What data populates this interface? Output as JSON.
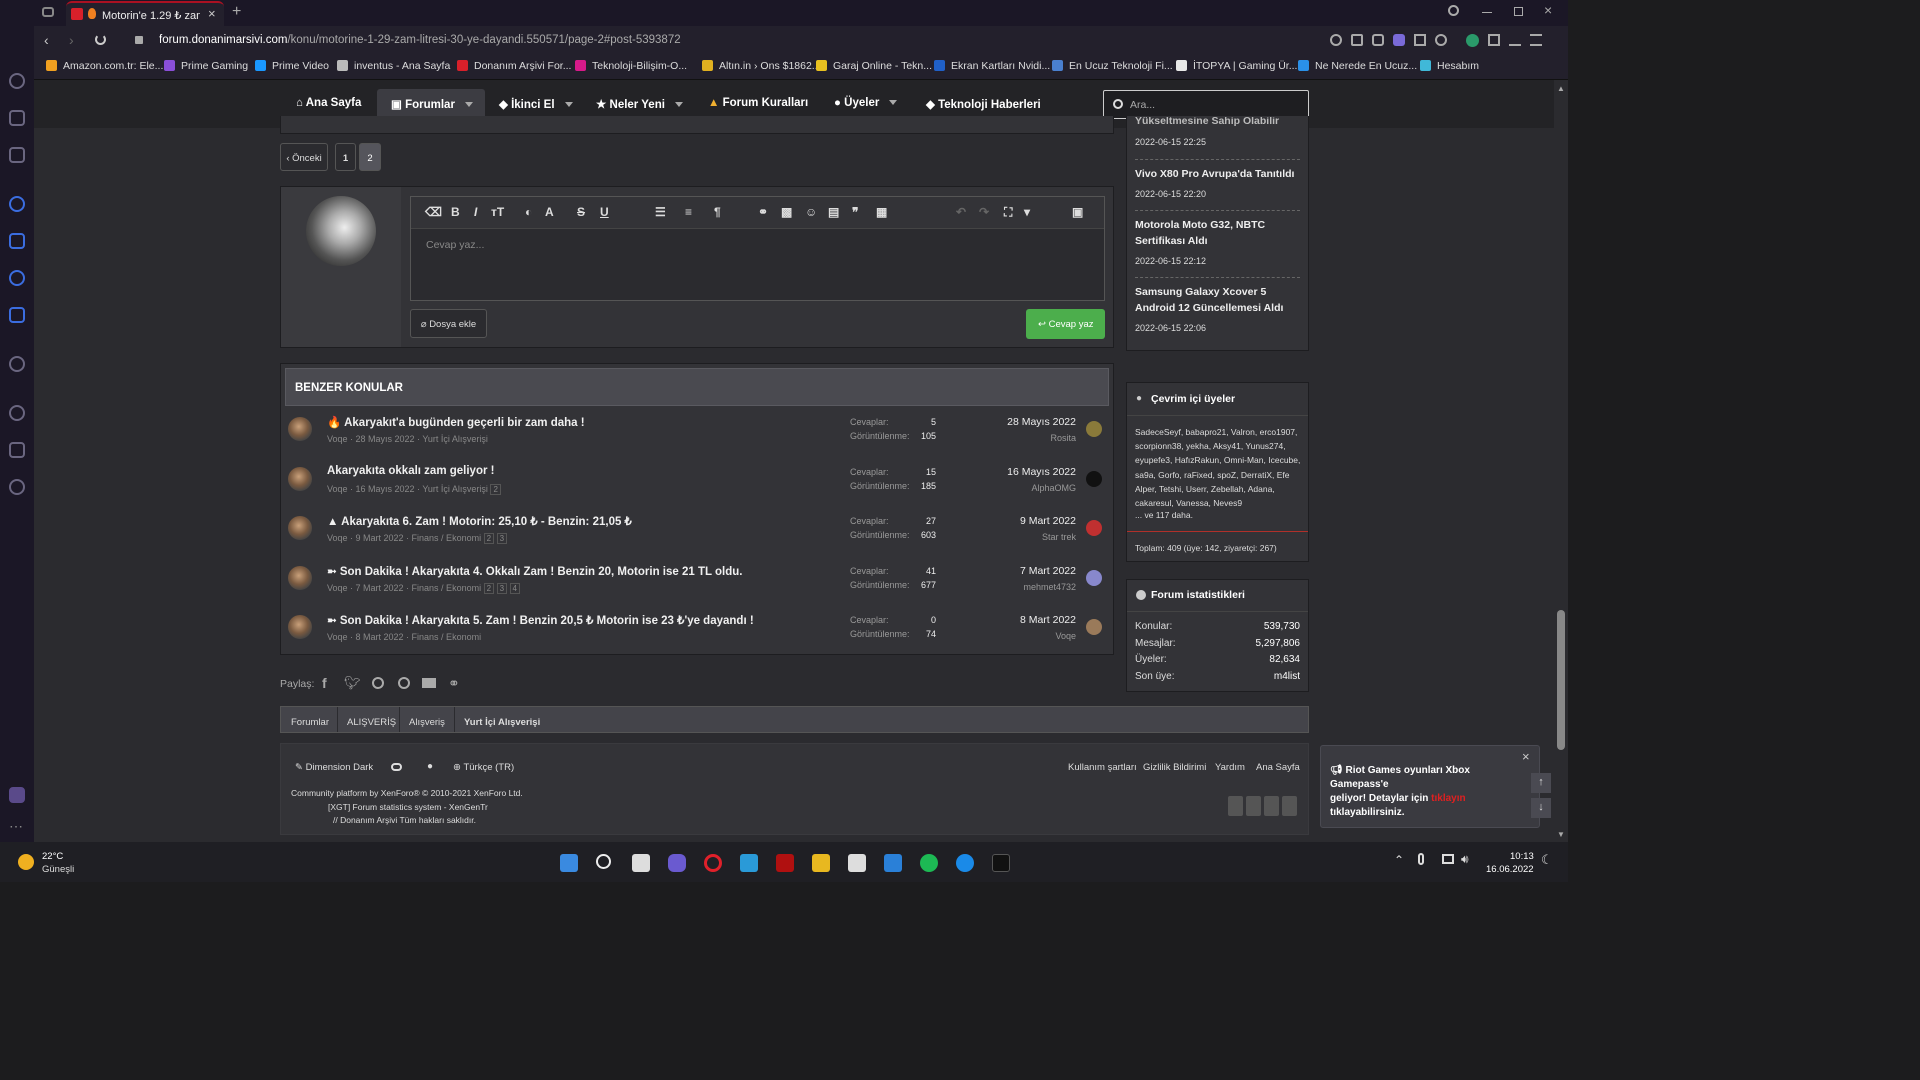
{
  "browser": {
    "tab_title": "Motorin'e 1.29 ₺ zam ! ",
    "url_domain": "forum.donanimarsivi.com",
    "url_path": "/konu/motorine-1-29-zam-litresi-30-ye-dayandi.550571/page-2#post-5393872",
    "bookmarks": [
      {
        "label": "Amazon.com.tr: Ele...",
        "color": "#f0a020"
      },
      {
        "label": "Prime Gaming",
        "color": "#8a4fd8"
      },
      {
        "label": "Prime Video",
        "color": "#1a98ff"
      },
      {
        "label": "inventus - Ana Sayfa",
        "color": "#bbbbbb"
      },
      {
        "label": "Donanım Arşivi For...",
        "color": "#d8202a"
      },
      {
        "label": "Teknoloji-Bilişim-O...",
        "color": "#d81a8a"
      },
      {
        "label": "Altın.in › Ons $1862...",
        "color": "#e0b020"
      },
      {
        "label": "Garaj Online - Tekn...",
        "color": "#e8c020"
      },
      {
        "label": "Ekran Kartları Nvidi...",
        "color": "#2060c8"
      },
      {
        "label": "En Ucuz Teknoloji Fi...",
        "color": "#4a80d0"
      },
      {
        "label": "İTOPYA | Gaming Ür...",
        "color": "#e8e8e8"
      },
      {
        "label": "Ne Nerede En Ucuz...",
        "color": "#2a90e8"
      },
      {
        "label": "Hesabım",
        "color": "#40b8d8"
      }
    ]
  },
  "nav": {
    "items": [
      {
        "label": "Ana Sayfa",
        "icon": "home-icon"
      },
      {
        "label": "Forumlar",
        "icon": "comments-icon"
      },
      {
        "label": "İkinci El",
        "icon": "tag-icon"
      },
      {
        "label": "Neler Yeni",
        "icon": "star-icon"
      },
      {
        "label": "Forum Kuralları",
        "icon": "warning-icon"
      },
      {
        "label": "Üyeler",
        "icon": "user-icon"
      },
      {
        "label": "Teknoloji Haberleri",
        "icon": "tag-icon"
      }
    ],
    "search_placeholder": "Ara..."
  },
  "pagination": {
    "prev": "‹ Önceki",
    "pages": [
      "1",
      "2"
    ]
  },
  "editor": {
    "placeholder": "Cevap yaz...",
    "attach": "Dosya ekle",
    "submit": "Cevap yaz"
  },
  "similar": {
    "title": "BENZER KONULAR",
    "replies_label": "Cevaplar:",
    "views_label": "Görüntülenme:",
    "threads": [
      {
        "prefix": "🔥",
        "title": "Akaryakıt'a bugünden geçerli bir zam daha !",
        "meta": "Voqe · 28 Mayıs 2022 · Yurt İçi Alışverişi",
        "pages": [],
        "replies": "5",
        "views": "105",
        "date": "28 Mayıs 2022",
        "last": "Rosita",
        "lastColor": "#8a7a3a"
      },
      {
        "prefix": "",
        "title": "Akaryakıta okkalı zam geliyor !",
        "meta": "Voqe · 16 Mayıs 2022 · Yurt İçi Alışverişi",
        "pages": [
          "2"
        ],
        "replies": "15",
        "views": "185",
        "date": "16 Mayıs 2022",
        "last": "AlphaOMG",
        "lastColor": "#111111"
      },
      {
        "prefix": "",
        "title": "▲ Akaryakıta 6. Zam ! Motorin: 25,10 ₺ - Benzin: 21,05 ₺",
        "meta": "Voqe · 9 Mart 2022 · Finans / Ekonomi",
        "pages": [
          "2",
          "3"
        ],
        "replies": "27",
        "views": "603",
        "date": "9 Mart 2022",
        "last": "Star trek",
        "lastColor": "#c03030"
      },
      {
        "prefix": "",
        "title": "➼ Son Dakika ! Akaryakıta 4. Okkalı Zam ! Benzin 20, Motorin ise 21 TL oldu.",
        "meta": "Voqe · 7 Mart 2022 · Finans / Ekonomi",
        "pages": [
          "2",
          "3",
          "4"
        ],
        "replies": "41",
        "views": "677",
        "date": "7 Mart 2022",
        "last": "mehmet4732",
        "lastColor": "#8888cc"
      },
      {
        "prefix": "",
        "title": "➼ Son Dakika ! Akaryakıta 5. Zam ! Benzin 20,5 ₺ Motorin ise 23 ₺'ye dayandı !",
        "meta": "Voqe · 8 Mart 2022 · Finans / Ekonomi",
        "pages": [],
        "replies": "0",
        "views": "74",
        "date": "8 Mart 2022",
        "last": "Voqe",
        "lastColor": "#9a7a5a"
      }
    ]
  },
  "share": {
    "label": "Paylaş:"
  },
  "breadcrumb": [
    "Forumlar",
    "ALIŞVERİŞ",
    "Alışveriş",
    "Yurt İçi Alışverişi"
  ],
  "footer": {
    "style": "Dimension Dark",
    "lang": "Türkçe (TR)",
    "links": [
      "Kullanım şartları",
      "Gizlilik Bildirimi",
      "Yardım",
      "Ana Sayfa"
    ],
    "copy1": "Community platform by XenForo® © 2010-2021 XenForo Ltd.",
    "copy2": "[XGT] Forum statistics system - XenGenTr",
    "copy3": "// Donanım Arşivi Tüm hakları saklıdır."
  },
  "news": [
    {
      "title": "Yükseltmesine Sahip Olabilir",
      "date": "2022-06-15 22:25"
    },
    {
      "title": "Vivo X80 Pro Avrupa'da Tanıtıldı",
      "date": "2022-06-15 22:20"
    },
    {
      "title": "Motorola Moto G32, NBTC Sertifikası Aldı",
      "date": "2022-06-15 22:12"
    },
    {
      "title": "Samsung Galaxy Xcover 5 Android 12 Güncellemesi Aldı",
      "date": "2022-06-15 22:06"
    }
  ],
  "online": {
    "title": "Çevrim içi üyeler",
    "members": "SadeceSeyf, babapro21, Valron, erco1907, scorpionn38, yekha, Aksy41, Yunus274, eyupefe3, HafızRakun, Omni-Man, Icecube, sa9a, Gorfo, raFixed, spoZ, DerratiX, Efe Alper, Tetshi, Userr, Zebellah, Adana, cakaresul, Vanessa, Neves9",
    "more": "... ve 117 daha.",
    "total": "Toplam: 409 (üye: 142, ziyaretçi: 267)"
  },
  "stats": {
    "title": "Forum istatistikleri",
    "rows": [
      {
        "label": "Konular:",
        "value": "539,730"
      },
      {
        "label": "Mesajlar:",
        "value": "5,297,806"
      },
      {
        "label": "Üyeler:",
        "value": "82,634"
      },
      {
        "label": "Son üye:",
        "value": "m4list"
      }
    ]
  },
  "toast": {
    "line1": "Riot Games oyunları Xbox Gamepass'e",
    "line2": "geliyor! Detaylar için",
    "link": "tıklayın",
    "line3": "tıklayabilirsiniz."
  },
  "taskbar": {
    "temp": "22°C",
    "weather": "Güneşli",
    "time": "10:13",
    "date": "16.06.2022"
  },
  "colors": {
    "accent_green": "#4cae4c",
    "bg": "#2b2b2f",
    "browser": "#1b1726"
  }
}
